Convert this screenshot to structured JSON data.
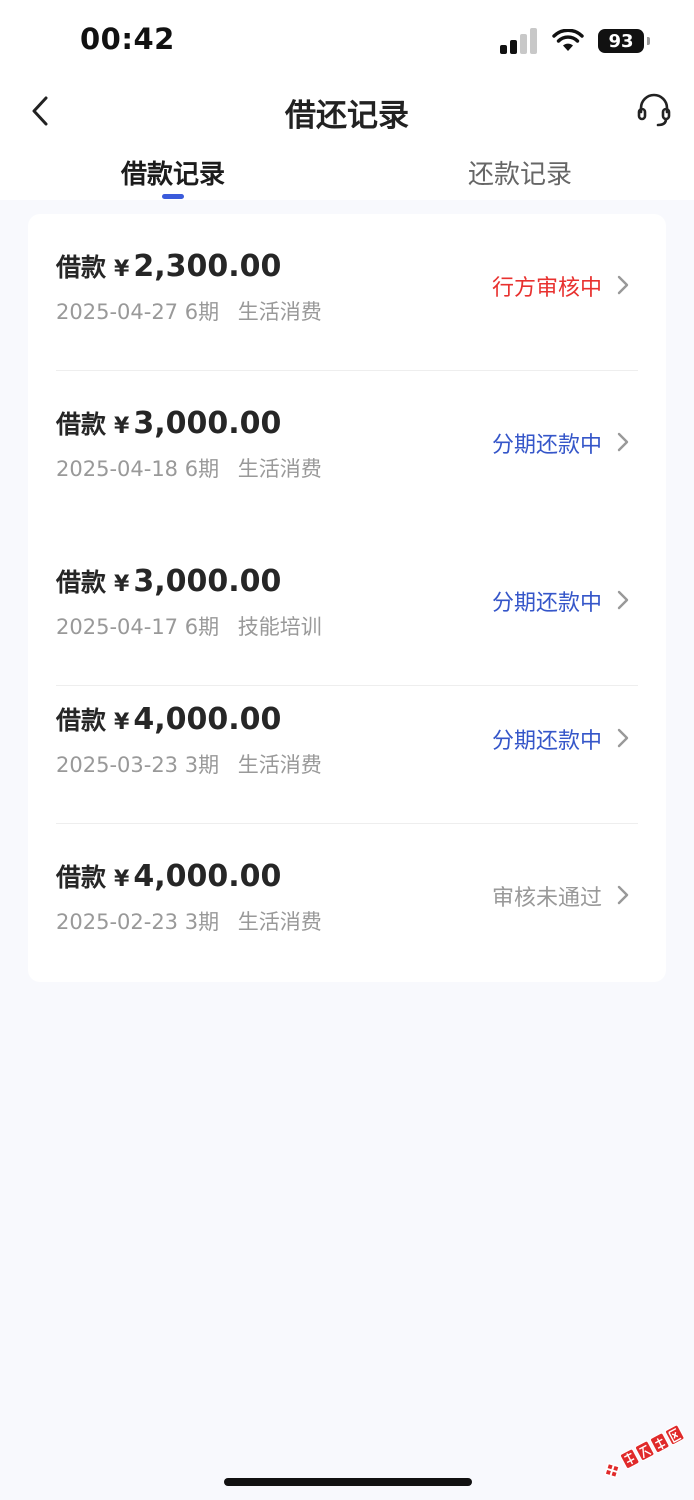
{
  "status_bar": {
    "time": "00:42",
    "battery": "93",
    "icons": [
      "signal-icon",
      "wifi-icon",
      "battery-icon"
    ]
  },
  "nav": {
    "title": "借还记录",
    "back_icon": "chevron-left-icon",
    "service_icon": "headset-icon"
  },
  "tabs": [
    {
      "label": "借款记录",
      "active": true
    },
    {
      "label": "还款记录",
      "active": false
    }
  ],
  "colors": {
    "accent": "#3b5bdb",
    "status_red": "#e8312f",
    "status_blue": "#3556c9",
    "status_gray": "#999999"
  },
  "records": [
    {
      "label": "借款",
      "currency": "¥",
      "amount": "2,300.00",
      "date": "2025-04-27",
      "term": "6期",
      "purpose": "生活消费",
      "status": "行方审核中",
      "status_color": "#e8312f"
    },
    {
      "label": "借款",
      "currency": "¥",
      "amount": "3,000.00",
      "date": "2025-04-18",
      "term": "6期",
      "purpose": "生活消费",
      "status": "分期还款中",
      "status_color": "#3556c9"
    },
    {
      "label": "借款",
      "currency": "¥",
      "amount": "3,000.00",
      "date": "2025-04-17",
      "term": "6期",
      "purpose": "技能培训",
      "status": "分期还款中",
      "status_color": "#3556c9"
    },
    {
      "label": "借款",
      "currency": "¥",
      "amount": "4,000.00",
      "date": "2025-03-23",
      "term": "3期",
      "purpose": "生活消费",
      "status": "分期还款中",
      "status_color": "#3556c9"
    },
    {
      "label": "借款",
      "currency": "¥",
      "amount": "4,000.00",
      "date": "2025-02-23",
      "term": "3期",
      "purpose": "生活消费",
      "status": "审核未通过",
      "status_color": "#999999"
    }
  ],
  "watermark": {
    "text": "卡农社区"
  }
}
